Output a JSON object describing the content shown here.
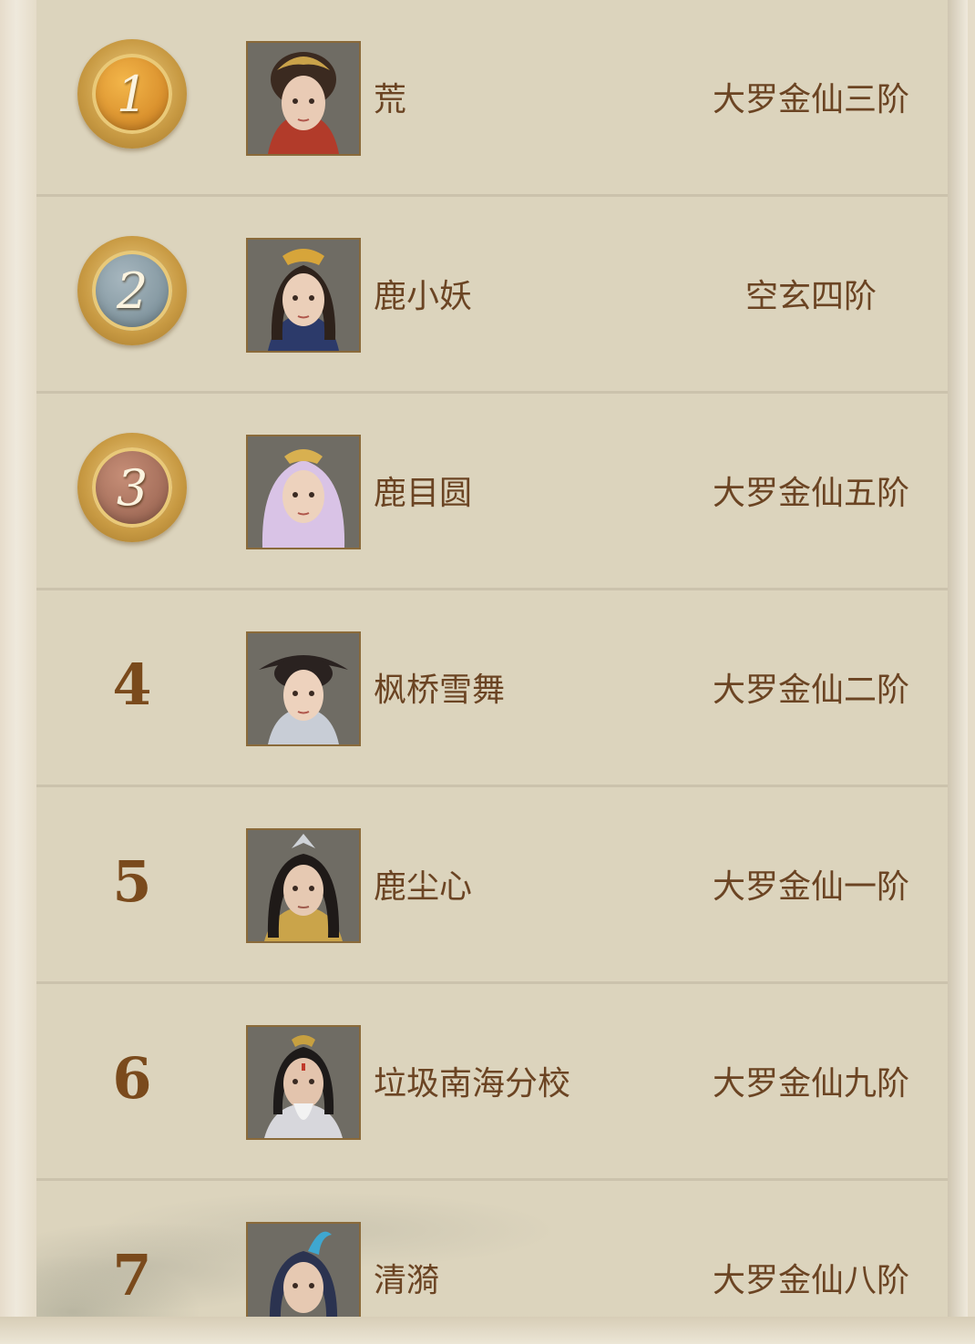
{
  "leaderboard": {
    "rows": [
      {
        "rank": "1",
        "medal": "gold-medal",
        "name": "荒",
        "title": "大罗金仙三阶",
        "avatar_hair": "#3b2a20",
        "avatar_accent": "#c9a24a"
      },
      {
        "rank": "2",
        "medal": "silver-medal",
        "name": "鹿小妖",
        "title": "空玄四阶",
        "avatar_hair": "#2e221b",
        "avatar_accent": "#d7a53a"
      },
      {
        "rank": "3",
        "medal": "bronze-medal",
        "name": "鹿目圆",
        "title": "大罗金仙五阶",
        "avatar_hair": "#d9c3e6",
        "avatar_accent": "#d8b050"
      },
      {
        "rank": "4",
        "medal": "",
        "name": "枫桥雪舞",
        "title": "大罗金仙二阶",
        "avatar_hair": "#2a2220",
        "avatar_accent": "#c8cdd6"
      },
      {
        "rank": "5",
        "medal": "",
        "name": "鹿尘心",
        "title": "大罗金仙一阶",
        "avatar_hair": "#1f1a18",
        "avatar_accent": "#caa44a"
      },
      {
        "rank": "6",
        "medal": "",
        "name": "垃圾南海分校",
        "title": "大罗金仙九阶",
        "avatar_hair": "#1d1a19",
        "avatar_accent": "#c7a040"
      },
      {
        "rank": "7",
        "medal": "",
        "name": "清漪",
        "title": "大罗金仙八阶",
        "avatar_hair": "#2b3350",
        "avatar_accent": "#3fa7d0"
      }
    ]
  }
}
